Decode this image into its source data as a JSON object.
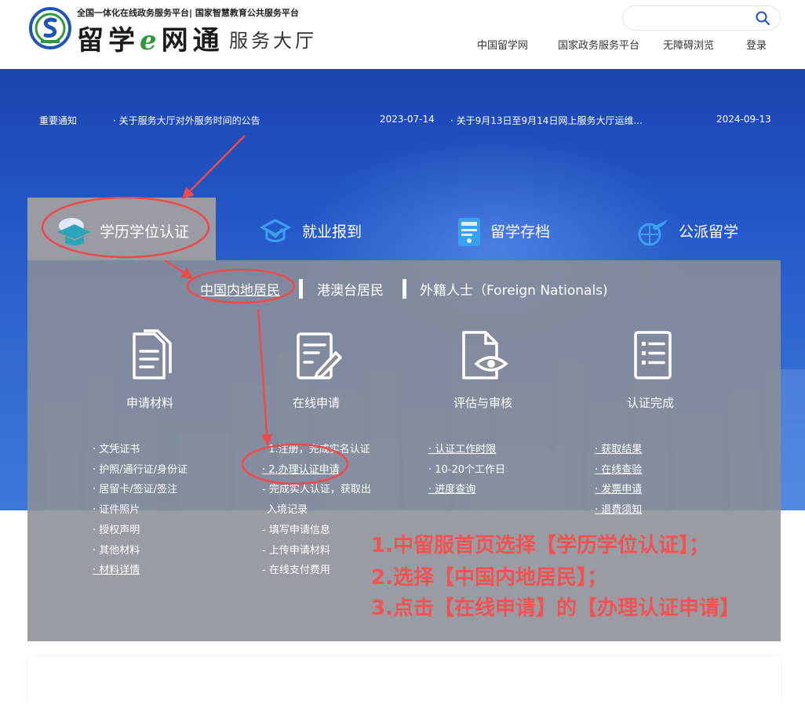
{
  "header": {
    "platform_tagline": "全国一体化在线政务服务平台| 国家智慧教育公共服务平台",
    "logo_text": "留学e网通",
    "logo_subtitle": "服务大厅",
    "search": {
      "placeholder": "",
      "icon": "search-icon"
    },
    "nav": [
      "中国留学网",
      "国家政务服务平台",
      "无障碍浏览",
      "登录"
    ]
  },
  "notices": {
    "label": "重要通知",
    "items": [
      {
        "title": "· 关于服务大厅对外服务时间的公告",
        "date": "2023-07-14"
      },
      {
        "title": "· 关于9月13日至9月14日网上服务大厅运维...",
        "date": "2024-09-13"
      }
    ]
  },
  "service_tabs": [
    {
      "label": "学历学位认证",
      "icon": "graduation-cap-icon",
      "active": true
    },
    {
      "label": "就业报到",
      "icon": "job-report-icon",
      "active": false
    },
    {
      "label": "留学存档",
      "icon": "archive-icon",
      "active": false
    },
    {
      "label": "公派留学",
      "icon": "airplane-globe-icon",
      "active": false
    }
  ],
  "resident_tabs": [
    "中国内地居民",
    "港澳台居民",
    "外籍人士（Foreign Nationals)"
  ],
  "steps": [
    {
      "label": "申请材料",
      "icon": "documents-icon",
      "items": [
        "· 文凭证书",
        "· 护照/通行证/身份证",
        "· 居留卡/签证/签注",
        "· 证件照片",
        "· 授权声明",
        "· 其他材料",
        "· 材料详情"
      ]
    },
    {
      "label": "在线申请",
      "icon": "form-edit-icon",
      "items": [
        "· 1.注册，完成实名认证",
        "· 2.办理认证申请",
        "- 完成实人认证，获取出",
        "入境记录",
        "- 填写申请信息",
        "- 上传申请材料",
        "- 在线支付费用"
      ]
    },
    {
      "label": "评估与审核",
      "icon": "document-eye-icon",
      "items": [
        "· 认证工作时限",
        "· 10-20个工作日",
        "· 进度查询"
      ]
    },
    {
      "label": "认证完成",
      "icon": "checklist-icon",
      "items": [
        "· 获取结果",
        "· 在线查验",
        "· 发票申请",
        "· 退费须知"
      ]
    }
  ],
  "instructions": [
    "1.中留服首页选择【学历学位认证】；",
    "2.选择【中国内地居民】；",
    "3.点击【在线申请】的【办理认证申请】"
  ],
  "colors": {
    "brand_blue": "#2458c6",
    "panel_gray": "#8c8e96",
    "annotation_red": "#f25252",
    "logo_green": "#2d9a3a"
  }
}
